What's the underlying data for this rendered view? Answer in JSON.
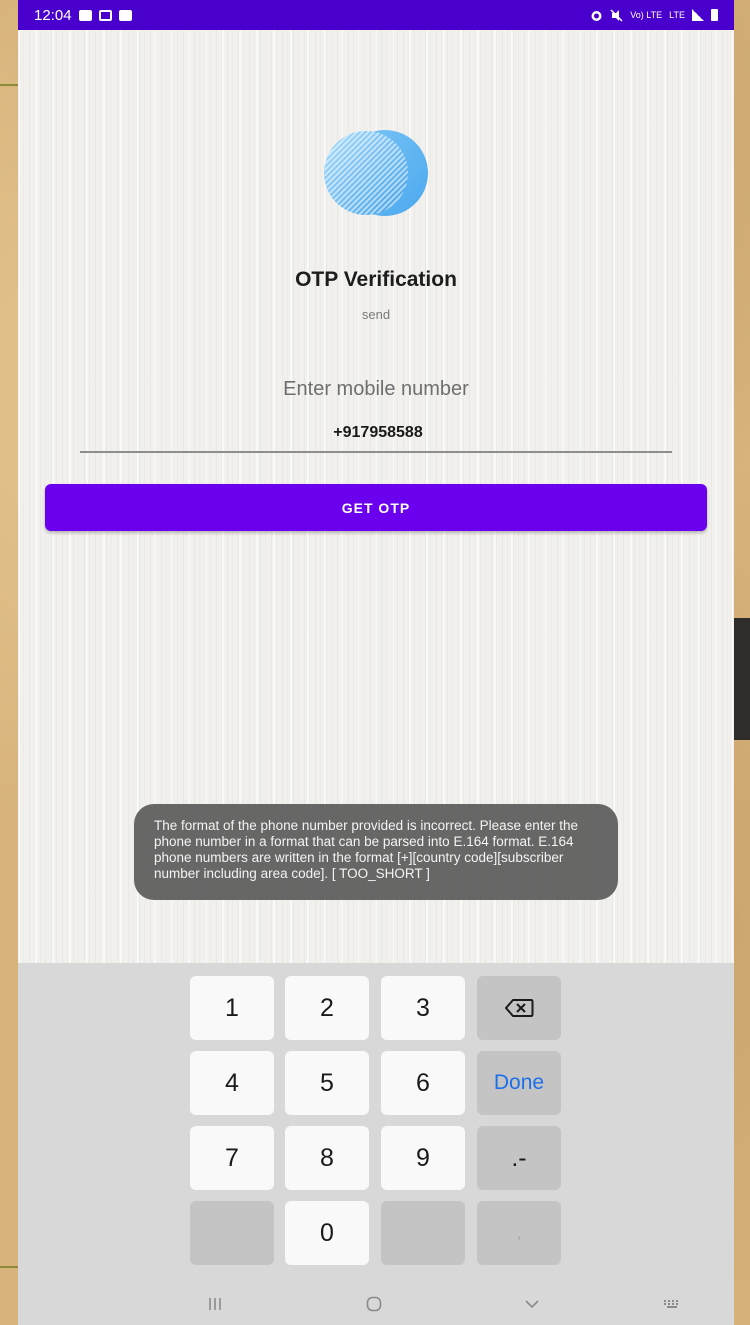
{
  "status_bar": {
    "time": "12:04",
    "left_icons": [
      "gallery-icon",
      "cast-icon",
      "checkbox-icon"
    ],
    "right_icons": [
      "alarm-icon",
      "mute-icon",
      "volte-icon",
      "lte-icon",
      "signal-icon",
      "battery-icon"
    ],
    "volte_text": "Vo) LTE",
    "lte_text": "LTE",
    "background": "#4a00cc"
  },
  "screen": {
    "logo": "circle-logo-icon",
    "title": "OTP Verification",
    "subtitle": "send",
    "phone_field": {
      "hint": "Enter mobile number",
      "value": "+917958588"
    },
    "button_label": "GET OTP",
    "accent_color": "#6a00ee"
  },
  "toast": {
    "message": "The format of the phone number provided is incorrect. Please enter the phone number in a format that can be parsed into E.164 format. E.164 phone numbers are written in the format [+][country code][subscriber number including area code]. [ TOO_SHORT ]"
  },
  "keyboard": {
    "keys": {
      "k1": "1",
      "k2": "2",
      "k3": "3",
      "k4": "4",
      "k5": "5",
      "k6": "6",
      "k7": "7",
      "k8": "8",
      "k9": "9",
      "k0": "0",
      "done": "Done",
      "dot_dash": ".-",
      "comma": ","
    },
    "backspace_icon": "backspace-icon",
    "done_color": "#1e70e8"
  },
  "nav_bar": {
    "buttons": [
      "recent-apps-icon",
      "home-icon",
      "back-icon",
      "keyboard-switch-icon"
    ]
  }
}
